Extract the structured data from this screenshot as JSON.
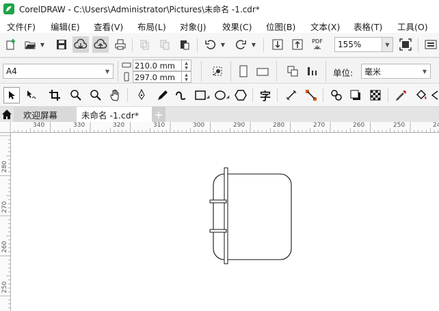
{
  "window": {
    "title": "CorelDRAW - C:\\Users\\Administrator\\Pictures\\未命名 -1.cdr*"
  },
  "menu": [
    {
      "label": "文件(F)",
      "name": "menu-file"
    },
    {
      "label": "编辑(E)",
      "name": "menu-edit"
    },
    {
      "label": "查看(V)",
      "name": "menu-view"
    },
    {
      "label": "布局(L)",
      "name": "menu-layout"
    },
    {
      "label": "对象(J)",
      "name": "menu-object"
    },
    {
      "label": "效果(C)",
      "name": "menu-effects"
    },
    {
      "label": "位图(B)",
      "name": "menu-bitmaps"
    },
    {
      "label": "文本(X)",
      "name": "menu-text"
    },
    {
      "label": "表格(T)",
      "name": "menu-table"
    },
    {
      "label": "工具(O)",
      "name": "menu-tools"
    }
  ],
  "standard_toolbar": {
    "pdf_label": "PDF",
    "zoom_value": "155%"
  },
  "property_bar": {
    "page_size": "A4",
    "width": "210.0 mm",
    "height": "297.0 mm",
    "units_label": "单位:",
    "units_value": "毫米"
  },
  "toolbox": {
    "text_tool_glyph": "字"
  },
  "tabs": {
    "welcome": "欢迎屏幕",
    "document": "未命名 -1.cdr*",
    "add": "+"
  },
  "rulers": {
    "horizontal": [
      "340",
      "330",
      "320",
      "310",
      "300",
      "290",
      "280",
      "270",
      "260",
      "250",
      "24"
    ],
    "vertical": [
      "280",
      "270",
      "260",
      "250"
    ]
  },
  "colors": {
    "app_logo": "#1fa34a",
    "pressed_button": "#d6d6d6",
    "toolbar_bg": "#f3f3f3"
  }
}
